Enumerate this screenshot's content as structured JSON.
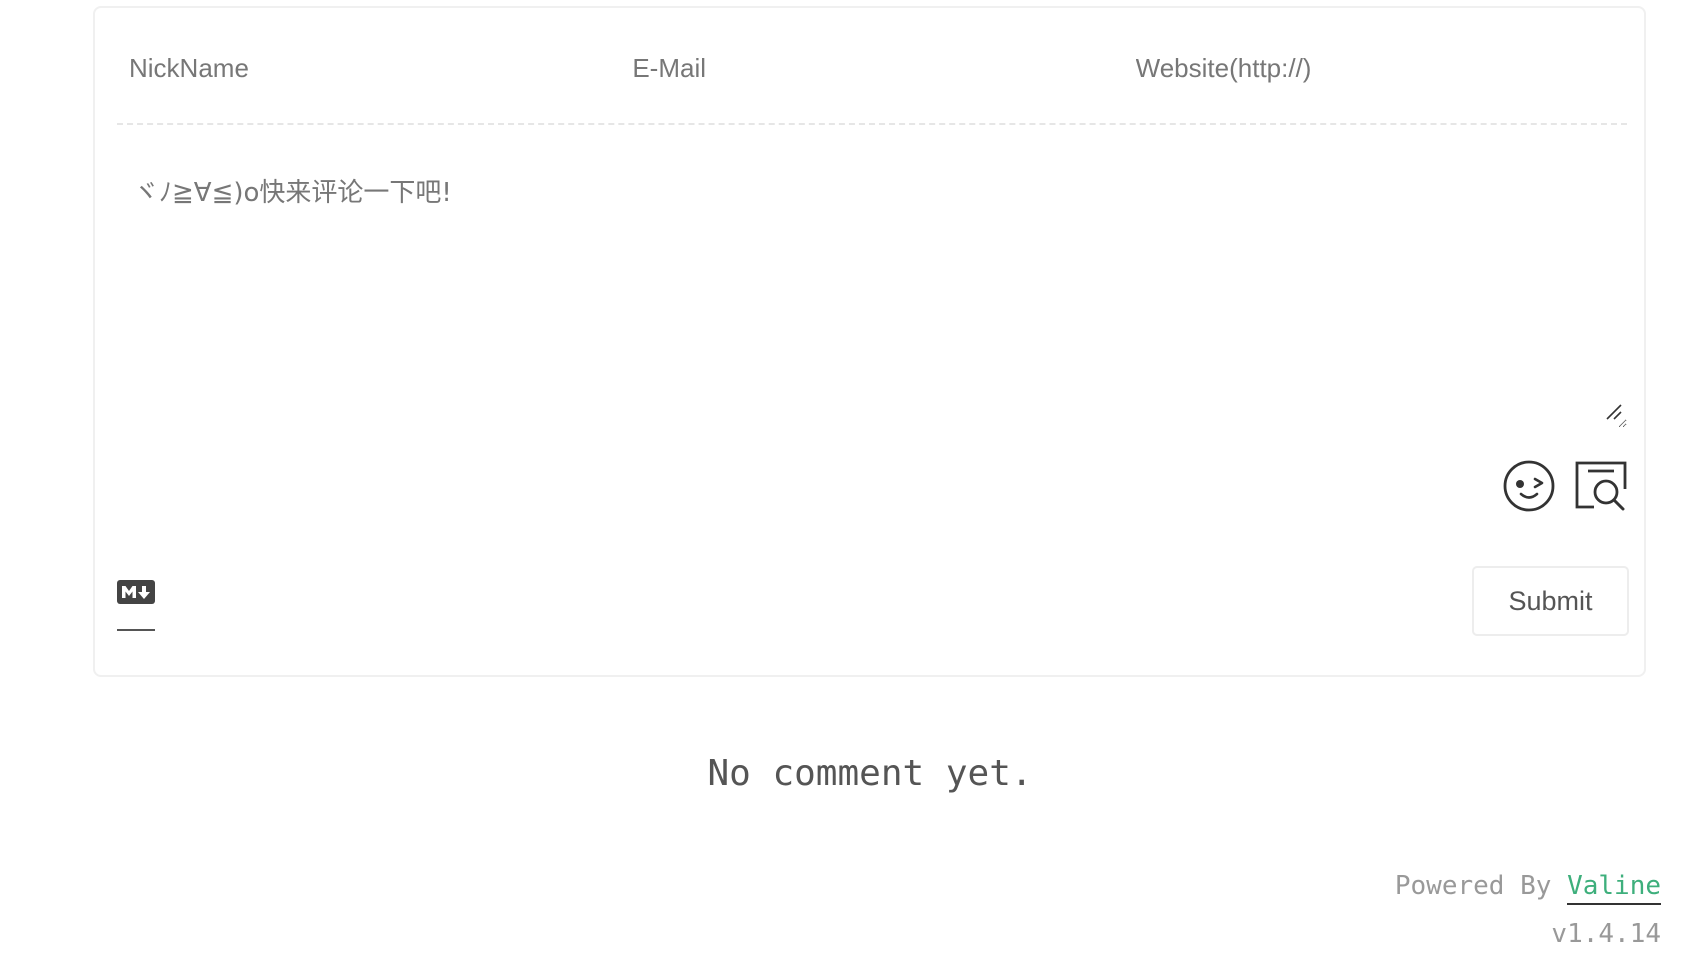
{
  "form": {
    "nick_placeholder": "NickName",
    "mail_placeholder": "E-Mail",
    "link_placeholder": "Website(http://)",
    "comment_placeholder": "ヾﾉ≧∀≦)o快来评论一下吧!",
    "submit_label": "Submit"
  },
  "icons": {
    "emoji": "emoji-icon",
    "preview": "preview-icon",
    "markdown": "markdown-icon"
  },
  "status": {
    "empty_text": "No comment yet."
  },
  "footer": {
    "powered_prefix": "Powered By",
    "powered_link": "Valine",
    "version": "v1.4.14"
  },
  "colors": {
    "accent": "#3eaf7c",
    "border": "#f0f0f0",
    "text": "#555555",
    "muted": "#999999"
  }
}
